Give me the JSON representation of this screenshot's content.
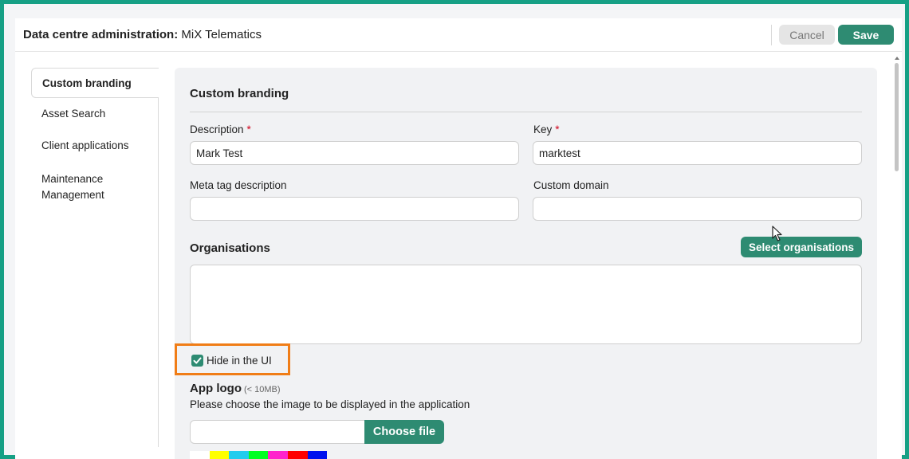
{
  "header": {
    "title_bold": "Data centre administration:",
    "title_rest": "MiX Telematics",
    "cancel_label": "Cancel",
    "save_label": "Save"
  },
  "sidebar": {
    "items": [
      {
        "label": "Custom branding",
        "active": true
      },
      {
        "label": "Asset Search",
        "active": false
      },
      {
        "label": "Client applications",
        "active": false
      },
      {
        "label": "Maintenance Management",
        "active": false
      }
    ]
  },
  "form": {
    "section_title": "Custom branding",
    "description": {
      "label": "Description",
      "required_mark": "*",
      "value": "Mark Test"
    },
    "key": {
      "label": "Key",
      "required_mark": "*",
      "value": "marktest"
    },
    "meta_tag": {
      "label": "Meta tag description",
      "value": ""
    },
    "custom_domain": {
      "label": "Custom domain",
      "value": ""
    },
    "organisations": {
      "title": "Organisations",
      "select_label": "Select organisations"
    },
    "hide_in_ui": {
      "label": "Hide in the UI",
      "checked": true
    },
    "app_logo": {
      "title": "App logo",
      "size_hint": "(< 10MB)",
      "description": "Please choose the image to be displayed in the application",
      "choose_label": "Choose file"
    },
    "swatch_colors": [
      "#ffffff",
      "#ffff00",
      "#22ccee",
      "#00ff22",
      "#ff22cc",
      "#ff0000",
      "#0011ee"
    ]
  },
  "colors": {
    "frame": "#16a085",
    "accent": "#2e8b72",
    "highlight": "#f07d17"
  }
}
